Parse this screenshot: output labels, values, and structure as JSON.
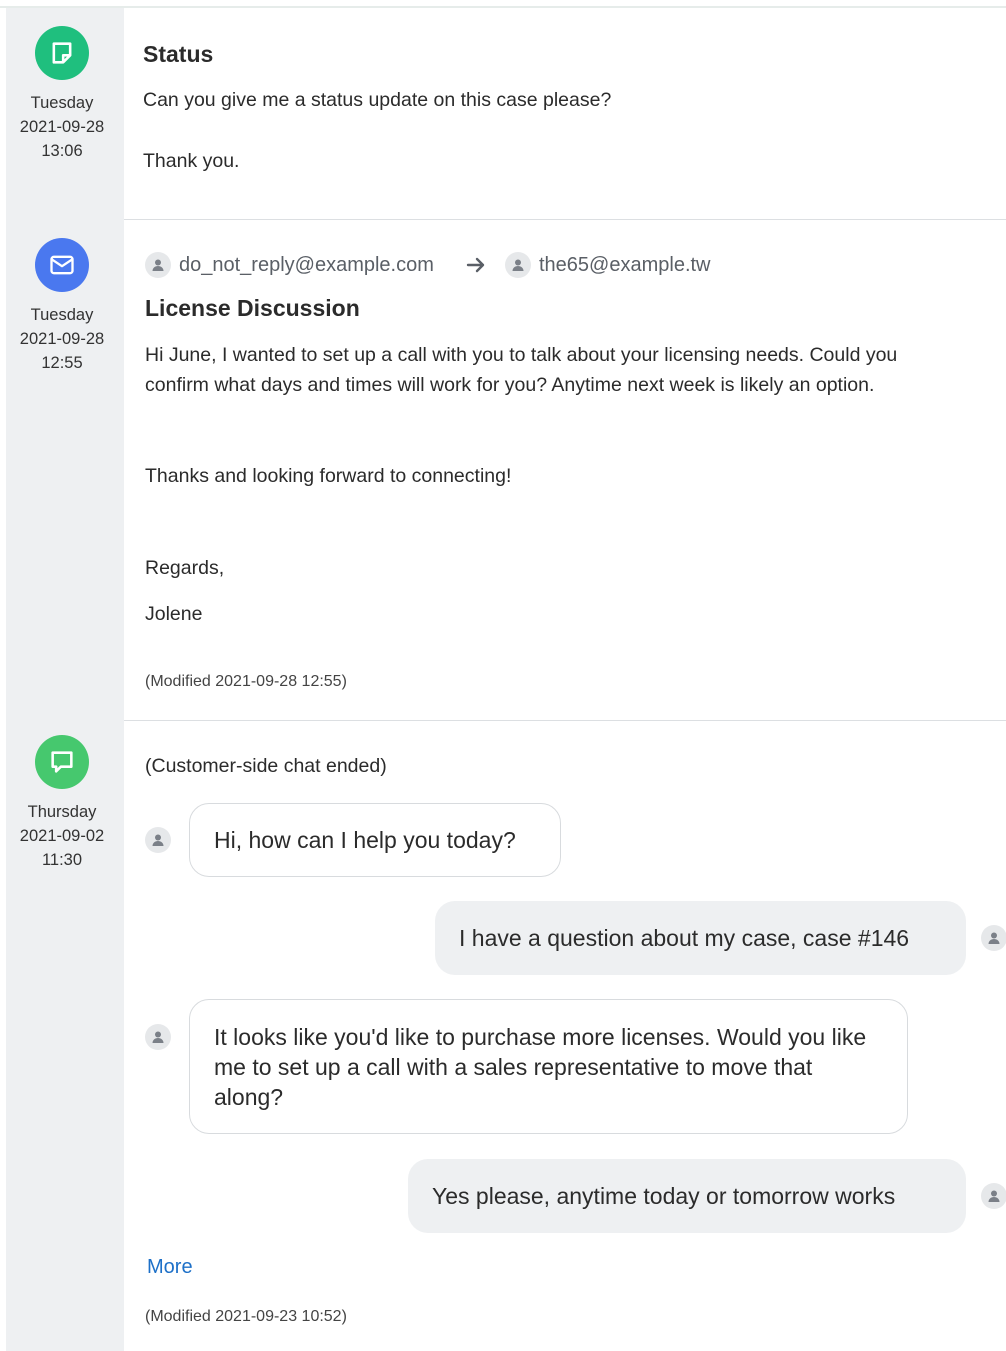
{
  "entries": [
    {
      "type": "note",
      "icon": "note-icon",
      "day": "Tuesday",
      "date": "2021-09-28",
      "time": "13:06",
      "title": "Status",
      "lines": [
        "Can you give me a status update on this case please?",
        "Thank you."
      ]
    },
    {
      "type": "email",
      "icon": "envelope-icon",
      "day": "Tuesday",
      "date": "2021-09-28",
      "time": "12:55",
      "from": "do_not_reply@example.com",
      "to": "the65@example.tw",
      "title": "License Discussion",
      "body_line1": "Hi June, I wanted to set up a call with you to talk about your licensing needs. Could you",
      "body_line2": "confirm what days and times will work for you? Anytime next week is likely an option.",
      "thanks": "Thanks and looking forward to connecting!",
      "regards": "Regards,",
      "signature": "Jolene",
      "modified": "(Modified 2021-09-28 12:55)"
    },
    {
      "type": "chat",
      "icon": "chat-bubble-icon",
      "day": "Thursday",
      "date": "2021-09-02",
      "time": "11:30",
      "status": "(Customer-side chat ended)",
      "messages": [
        {
          "side": "agent",
          "text": "Hi, how can I help you today?"
        },
        {
          "side": "customer",
          "text": "I have a question about my case, case #146"
        },
        {
          "side": "agent",
          "text": "It looks like you'd like to purchase more licenses. Would you like me to set up a call with a sales representative to move that along?"
        },
        {
          "side": "customer",
          "text": "Yes please, anytime today or tomorrow works"
        }
      ],
      "more_label": "More",
      "modified": "(Modified 2021-09-23 10:52)"
    }
  ],
  "colors": {
    "note_badge": "#1fbf7e",
    "email_badge": "#4a78ef",
    "chat_badge": "#46c86e",
    "link": "#1d70c8",
    "timeline_bg": "#eef0f2"
  }
}
